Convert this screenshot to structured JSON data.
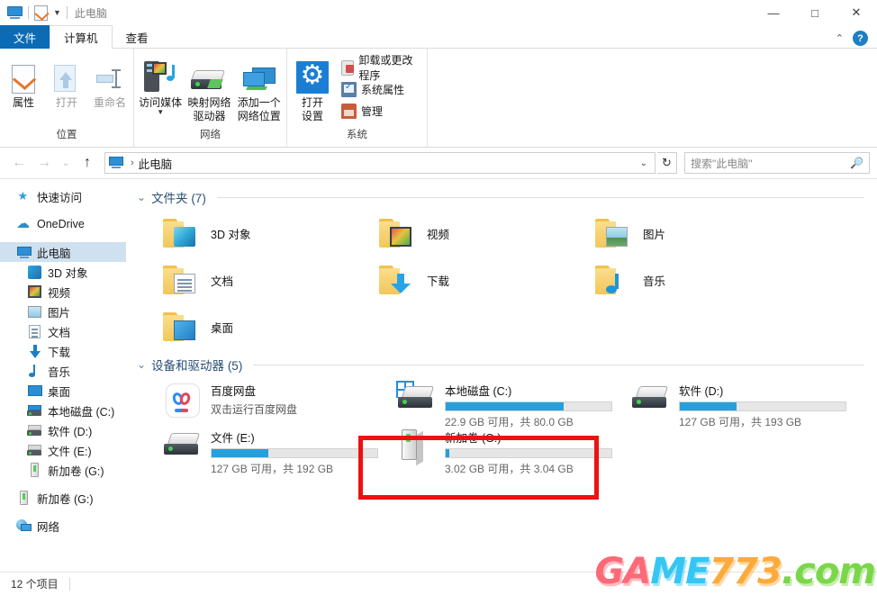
{
  "window": {
    "title": "此电脑",
    "quick_access_icons": [
      "computer-icon",
      "properties-icon",
      "dropdown-caret"
    ],
    "controls": {
      "minimize": "—",
      "maximize": "□",
      "close": "✕",
      "collapse_ribbon": "⌃",
      "help": "?"
    }
  },
  "tabs": [
    {
      "label": "文件",
      "state": "file-menu"
    },
    {
      "label": "计算机",
      "state": "active"
    },
    {
      "label": "查看",
      "state": "normal"
    }
  ],
  "ribbon": {
    "groups": [
      {
        "label": "位置",
        "buttons": [
          {
            "label": "属性",
            "icon": "properties-icon",
            "enabled": true
          },
          {
            "label": "打开",
            "icon": "open-icon",
            "enabled": false
          },
          {
            "label": "重命名",
            "icon": "rename-icon",
            "enabled": false
          }
        ]
      },
      {
        "label": "网络",
        "buttons": [
          {
            "label": "访问媒体",
            "label2": "",
            "icon": "media-server-icon",
            "dropdown": true
          },
          {
            "label": "映射网络",
            "label2": "驱动器",
            "icon": "map-drive-icon",
            "dropdown": true
          },
          {
            "label": "添加一个",
            "label2": "网络位置",
            "icon": "add-network-location-icon",
            "dropdown": false
          }
        ]
      },
      {
        "label": "系统",
        "big_button": {
          "label1": "打开",
          "label2": "设置",
          "icon": "settings-gear-icon"
        },
        "small_buttons": [
          {
            "label": "卸载或更改程序",
            "icon": "uninstall-icon"
          },
          {
            "label": "系统属性",
            "icon": "system-properties-icon"
          },
          {
            "label": "管理",
            "icon": "manage-icon"
          }
        ]
      }
    ]
  },
  "address_bar": {
    "back": "←",
    "forward": "→",
    "recent": "⌄",
    "up": "↑",
    "breadcrumb_icon": "computer-icon",
    "breadcrumb_separator": "›",
    "breadcrumb": "此电脑",
    "dropdown": "⌄",
    "refresh": "↻"
  },
  "search": {
    "placeholder": "搜索\"此电脑\"",
    "icon": "search-icon"
  },
  "sidebar": {
    "items": [
      {
        "label": "快速访问",
        "icon": "star-icon",
        "indent": 0,
        "selected": false,
        "gap_before": false
      },
      {
        "label": "OneDrive",
        "icon": "cloud-icon",
        "indent": 0,
        "selected": false,
        "gap_before": true
      },
      {
        "label": "此电脑",
        "icon": "computer-icon",
        "indent": 0,
        "selected": true,
        "gap_before": true
      },
      {
        "label": "3D 对象",
        "icon": "3d-objects-icon",
        "indent": 1,
        "selected": false,
        "gap_before": false
      },
      {
        "label": "视频",
        "icon": "videos-icon",
        "indent": 1,
        "selected": false,
        "gap_before": false
      },
      {
        "label": "图片",
        "icon": "pictures-icon",
        "indent": 1,
        "selected": false,
        "gap_before": false
      },
      {
        "label": "文档",
        "icon": "documents-icon",
        "indent": 1,
        "selected": false,
        "gap_before": false
      },
      {
        "label": "下载",
        "icon": "downloads-icon",
        "indent": 1,
        "selected": false,
        "gap_before": false
      },
      {
        "label": "音乐",
        "icon": "music-icon",
        "indent": 1,
        "selected": false,
        "gap_before": false
      },
      {
        "label": "桌面",
        "icon": "desktop-icon",
        "indent": 1,
        "selected": false,
        "gap_before": false
      },
      {
        "label": "本地磁盘 (C:)",
        "icon": "windows-drive-icon",
        "indent": 1,
        "selected": false,
        "gap_before": false
      },
      {
        "label": "软件 (D:)",
        "icon": "hard-drive-icon",
        "indent": 1,
        "selected": false,
        "gap_before": false
      },
      {
        "label": "文件 (E:)",
        "icon": "hard-drive-icon",
        "indent": 1,
        "selected": false,
        "gap_before": false
      },
      {
        "label": "新加卷 (G:)",
        "icon": "volume-icon",
        "indent": 1,
        "selected": false,
        "gap_before": false
      },
      {
        "label": "新加卷 (G:)",
        "icon": "volume-icon",
        "indent": 0,
        "selected": false,
        "gap_before": true
      },
      {
        "label": "网络",
        "icon": "network-icon",
        "indent": 0,
        "selected": false,
        "gap_before": true
      }
    ]
  },
  "content": {
    "folders_section": {
      "chevron": "⌄",
      "title": "文件夹 (7)"
    },
    "folders": [
      {
        "label": "3D 对象",
        "icon": "folder-3d-objects"
      },
      {
        "label": "视频",
        "icon": "folder-videos"
      },
      {
        "label": "图片",
        "icon": "folder-pictures"
      },
      {
        "label": "文档",
        "icon": "folder-documents"
      },
      {
        "label": "下载",
        "icon": "folder-downloads"
      },
      {
        "label": "音乐",
        "icon": "folder-music"
      },
      {
        "label": "桌面",
        "icon": "folder-desktop"
      }
    ],
    "devices_section": {
      "chevron": "⌄",
      "title": "设备和驱动器 (5)"
    },
    "devices": [
      {
        "name": "百度网盘",
        "subtitle": "双击运行百度网盘",
        "icon": "baidu-netdisk-icon",
        "has_bar": false
      },
      {
        "name": "本地磁盘 (C:)",
        "icon": "windows-drive-icon",
        "has_bar": true,
        "free": "22.9 GB",
        "total": "80.0 GB",
        "usage_text": "22.9 GB 可用，共 80.0 GB",
        "used_percent": 71,
        "bar_color": "#26a0da",
        "highlighted": false
      },
      {
        "name": "软件 (D:)",
        "icon": "hard-drive-icon",
        "has_bar": true,
        "free": "127 GB",
        "total": "193 GB",
        "usage_text": "127 GB 可用，共 193 GB",
        "used_percent": 34,
        "bar_color": "#26a0da",
        "highlighted": false
      },
      {
        "name": "文件 (E:)",
        "icon": "hard-drive-icon",
        "has_bar": true,
        "free": "127 GB",
        "total": "192 GB",
        "usage_text": "127 GB 可用，共 192 GB",
        "used_percent": 34,
        "bar_color": "#26a0da",
        "highlighted": false
      },
      {
        "name": "新加卷 (G:)",
        "icon": "volume-icon",
        "has_bar": true,
        "free": "3.02 GB",
        "total": "3.04 GB",
        "usage_text": "3.02 GB 可用，共 3.04 GB",
        "used_percent": 2,
        "bar_color": "#26a0da",
        "highlighted": true
      }
    ]
  },
  "status_bar": {
    "item_count": "12 个项目"
  },
  "watermark": {
    "part1": "GA",
    "part2": "ME",
    "part3": "773",
    "part4": ".com"
  },
  "colors": {
    "accent": "#0b6cb5",
    "selection": "#cfe0ef",
    "drive_bar": "#26a0da",
    "highlight_box": "#ee1111",
    "section_title": "#2a4f75"
  }
}
